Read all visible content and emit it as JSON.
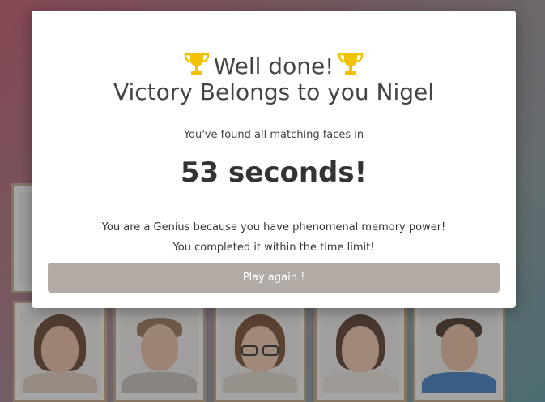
{
  "modal": {
    "title_line1": "Well done!",
    "title_line2": "Victory Belongs to you Nigel",
    "found_text": "You've found all matching faces in",
    "time_text": "53 seconds!",
    "message_line1": "You are a Genius because you have phenomenal memory power!",
    "message_line2": "You completed it within the time limit!",
    "play_again_label": "Play again !"
  },
  "icons": {
    "trophy": "trophy-icon"
  },
  "colors": {
    "button_bg": "#b1aaa5",
    "card_border": "#b89d7c",
    "trophy": "#f2c200"
  }
}
